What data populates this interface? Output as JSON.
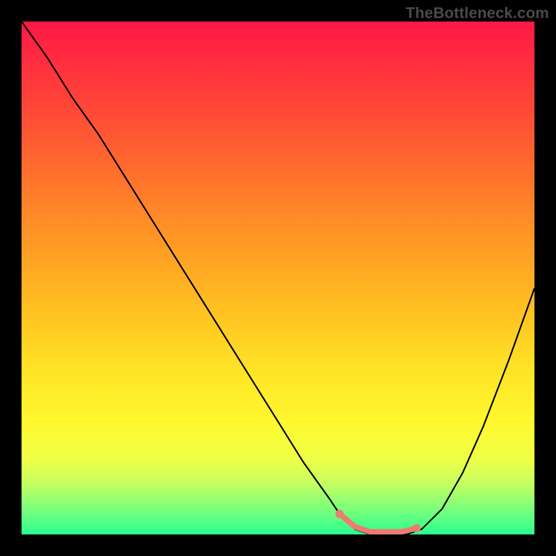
{
  "watermark": "TheBottleneck.com",
  "chart_data": {
    "type": "line",
    "title": "",
    "xlabel": "",
    "ylabel": "",
    "xlim": [
      0,
      100
    ],
    "ylim": [
      0,
      100
    ],
    "grid": false,
    "legend": false,
    "background": "vertical-gradient red→yellow→green",
    "series": [
      {
        "name": "bottleneck-curve",
        "color": "#000000",
        "x": [
          0,
          5,
          10,
          15,
          20,
          25,
          30,
          35,
          40,
          45,
          50,
          55,
          60,
          62,
          65,
          68,
          72,
          75,
          78,
          82,
          86,
          90,
          95,
          100
        ],
        "y": [
          100,
          93,
          85,
          78,
          70,
          62,
          54,
          46,
          38,
          30,
          22,
          14,
          7,
          4,
          1,
          0,
          0,
          0,
          1,
          5,
          12,
          21,
          34,
          48
        ]
      },
      {
        "name": "optimal-range-markers",
        "color": "#ef7a72",
        "x": [
          62,
          65,
          68,
          71,
          74,
          77
        ],
        "y": [
          4,
          1.5,
          0.5,
          0.5,
          0.5,
          1.2
        ]
      }
    ],
    "annotations": []
  }
}
